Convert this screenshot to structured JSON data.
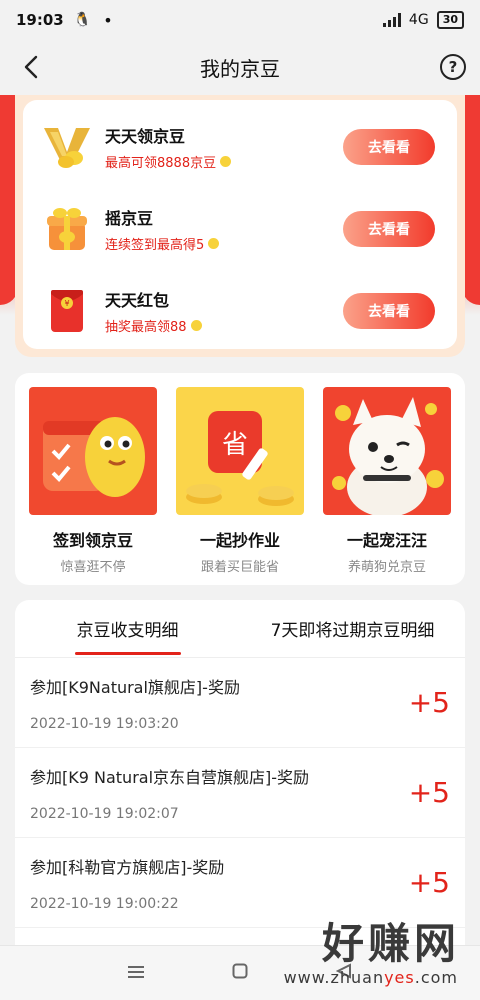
{
  "status": {
    "time": "19:03",
    "qq": "🐧",
    "dot": "•",
    "network": "4G",
    "battery": "30"
  },
  "nav": {
    "title": "我的京豆",
    "help": "?"
  },
  "tasks": [
    {
      "title": "天天领京豆",
      "sub": "最高可领8888京豆",
      "button": "去看看",
      "icon": "vip-bean-icon"
    },
    {
      "title": "摇京豆",
      "sub": "连续签到最高得5",
      "button": "去看看",
      "icon": "gift-box-icon"
    },
    {
      "title": "天天红包",
      "sub": "抽奖最高领88",
      "button": "去看看",
      "icon": "red-envelope-icon"
    }
  ],
  "promos": [
    {
      "title": "签到领京豆",
      "sub": "惊喜逛不停"
    },
    {
      "title": "一起抄作业",
      "sub": "跟着买巨能省"
    },
    {
      "title": "一起宠汪汪",
      "sub": "养萌狗兑京豆"
    }
  ],
  "tabs": [
    "京豆收支明细",
    "7天即将过期京豆明细"
  ],
  "records": [
    {
      "title": "参加[K9Natural旗舰店]-奖励",
      "time": "2022-10-19 19:03:20",
      "amount": "+5"
    },
    {
      "title": "参加[K9 Natural京东自营旗舰店]-奖励",
      "time": "2022-10-19 19:02:07",
      "amount": "+5"
    },
    {
      "title": "参加[科勒官方旗舰店]-奖励",
      "time": "2022-10-19 19:00:22",
      "amount": "+5"
    }
  ],
  "watermark": {
    "text": "好赚网",
    "url_a": "www.zhuan",
    "url_b": "yes",
    "url_c": ".com"
  },
  "colors": {
    "accent": "#e2231a",
    "bean": "#f7d23a"
  }
}
